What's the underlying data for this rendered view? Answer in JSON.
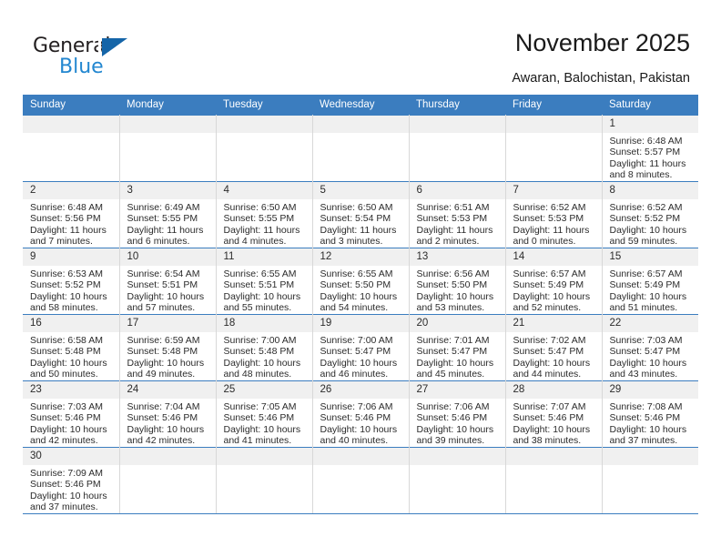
{
  "logo": {
    "word_top": "General",
    "word_bottom": "Blue",
    "triangle_color": "#1565a8",
    "blue_color": "#2387d0"
  },
  "header": {
    "title": "November 2025",
    "subtitle": "Awaran, Balochistan, Pakistan"
  },
  "calendar": {
    "accent_color": "#3b7dbf",
    "daynum_bg": "#f0f0f0",
    "weekdays": [
      "Sunday",
      "Monday",
      "Tuesday",
      "Wednesday",
      "Thursday",
      "Friday",
      "Saturday"
    ],
    "weeks": [
      [
        {
          "day": "",
          "lines": []
        },
        {
          "day": "",
          "lines": []
        },
        {
          "day": "",
          "lines": []
        },
        {
          "day": "",
          "lines": []
        },
        {
          "day": "",
          "lines": []
        },
        {
          "day": "",
          "lines": []
        },
        {
          "day": "1",
          "lines": [
            "Sunrise: 6:48 AM",
            "Sunset: 5:57 PM",
            "Daylight: 11 hours",
            "and 8 minutes."
          ]
        }
      ],
      [
        {
          "day": "2",
          "lines": [
            "Sunrise: 6:48 AM",
            "Sunset: 5:56 PM",
            "Daylight: 11 hours",
            "and 7 minutes."
          ]
        },
        {
          "day": "3",
          "lines": [
            "Sunrise: 6:49 AM",
            "Sunset: 5:55 PM",
            "Daylight: 11 hours",
            "and 6 minutes."
          ]
        },
        {
          "day": "4",
          "lines": [
            "Sunrise: 6:50 AM",
            "Sunset: 5:55 PM",
            "Daylight: 11 hours",
            "and 4 minutes."
          ]
        },
        {
          "day": "5",
          "lines": [
            "Sunrise: 6:50 AM",
            "Sunset: 5:54 PM",
            "Daylight: 11 hours",
            "and 3 minutes."
          ]
        },
        {
          "day": "6",
          "lines": [
            "Sunrise: 6:51 AM",
            "Sunset: 5:53 PM",
            "Daylight: 11 hours",
            "and 2 minutes."
          ]
        },
        {
          "day": "7",
          "lines": [
            "Sunrise: 6:52 AM",
            "Sunset: 5:53 PM",
            "Daylight: 11 hours",
            "and 0 minutes."
          ]
        },
        {
          "day": "8",
          "lines": [
            "Sunrise: 6:52 AM",
            "Sunset: 5:52 PM",
            "Daylight: 10 hours",
            "and 59 minutes."
          ]
        }
      ],
      [
        {
          "day": "9",
          "lines": [
            "Sunrise: 6:53 AM",
            "Sunset: 5:52 PM",
            "Daylight: 10 hours",
            "and 58 minutes."
          ]
        },
        {
          "day": "10",
          "lines": [
            "Sunrise: 6:54 AM",
            "Sunset: 5:51 PM",
            "Daylight: 10 hours",
            "and 57 minutes."
          ]
        },
        {
          "day": "11",
          "lines": [
            "Sunrise: 6:55 AM",
            "Sunset: 5:51 PM",
            "Daylight: 10 hours",
            "and 55 minutes."
          ]
        },
        {
          "day": "12",
          "lines": [
            "Sunrise: 6:55 AM",
            "Sunset: 5:50 PM",
            "Daylight: 10 hours",
            "and 54 minutes."
          ]
        },
        {
          "day": "13",
          "lines": [
            "Sunrise: 6:56 AM",
            "Sunset: 5:50 PM",
            "Daylight: 10 hours",
            "and 53 minutes."
          ]
        },
        {
          "day": "14",
          "lines": [
            "Sunrise: 6:57 AM",
            "Sunset: 5:49 PM",
            "Daylight: 10 hours",
            "and 52 minutes."
          ]
        },
        {
          "day": "15",
          "lines": [
            "Sunrise: 6:57 AM",
            "Sunset: 5:49 PM",
            "Daylight: 10 hours",
            "and 51 minutes."
          ]
        }
      ],
      [
        {
          "day": "16",
          "lines": [
            "Sunrise: 6:58 AM",
            "Sunset: 5:48 PM",
            "Daylight: 10 hours",
            "and 50 minutes."
          ]
        },
        {
          "day": "17",
          "lines": [
            "Sunrise: 6:59 AM",
            "Sunset: 5:48 PM",
            "Daylight: 10 hours",
            "and 49 minutes."
          ]
        },
        {
          "day": "18",
          "lines": [
            "Sunrise: 7:00 AM",
            "Sunset: 5:48 PM",
            "Daylight: 10 hours",
            "and 48 minutes."
          ]
        },
        {
          "day": "19",
          "lines": [
            "Sunrise: 7:00 AM",
            "Sunset: 5:47 PM",
            "Daylight: 10 hours",
            "and 46 minutes."
          ]
        },
        {
          "day": "20",
          "lines": [
            "Sunrise: 7:01 AM",
            "Sunset: 5:47 PM",
            "Daylight: 10 hours",
            "and 45 minutes."
          ]
        },
        {
          "day": "21",
          "lines": [
            "Sunrise: 7:02 AM",
            "Sunset: 5:47 PM",
            "Daylight: 10 hours",
            "and 44 minutes."
          ]
        },
        {
          "day": "22",
          "lines": [
            "Sunrise: 7:03 AM",
            "Sunset: 5:47 PM",
            "Daylight: 10 hours",
            "and 43 minutes."
          ]
        }
      ],
      [
        {
          "day": "23",
          "lines": [
            "Sunrise: 7:03 AM",
            "Sunset: 5:46 PM",
            "Daylight: 10 hours",
            "and 42 minutes."
          ]
        },
        {
          "day": "24",
          "lines": [
            "Sunrise: 7:04 AM",
            "Sunset: 5:46 PM",
            "Daylight: 10 hours",
            "and 42 minutes."
          ]
        },
        {
          "day": "25",
          "lines": [
            "Sunrise: 7:05 AM",
            "Sunset: 5:46 PM",
            "Daylight: 10 hours",
            "and 41 minutes."
          ]
        },
        {
          "day": "26",
          "lines": [
            "Sunrise: 7:06 AM",
            "Sunset: 5:46 PM",
            "Daylight: 10 hours",
            "and 40 minutes."
          ]
        },
        {
          "day": "27",
          "lines": [
            "Sunrise: 7:06 AM",
            "Sunset: 5:46 PM",
            "Daylight: 10 hours",
            "and 39 minutes."
          ]
        },
        {
          "day": "28",
          "lines": [
            "Sunrise: 7:07 AM",
            "Sunset: 5:46 PM",
            "Daylight: 10 hours",
            "and 38 minutes."
          ]
        },
        {
          "day": "29",
          "lines": [
            "Sunrise: 7:08 AM",
            "Sunset: 5:46 PM",
            "Daylight: 10 hours",
            "and 37 minutes."
          ]
        }
      ],
      [
        {
          "day": "30",
          "lines": [
            "Sunrise: 7:09 AM",
            "Sunset: 5:46 PM",
            "Daylight: 10 hours",
            "and 37 minutes."
          ]
        },
        {
          "day": "",
          "lines": []
        },
        {
          "day": "",
          "lines": []
        },
        {
          "day": "",
          "lines": []
        },
        {
          "day": "",
          "lines": []
        },
        {
          "day": "",
          "lines": []
        },
        {
          "day": "",
          "lines": []
        }
      ]
    ]
  }
}
